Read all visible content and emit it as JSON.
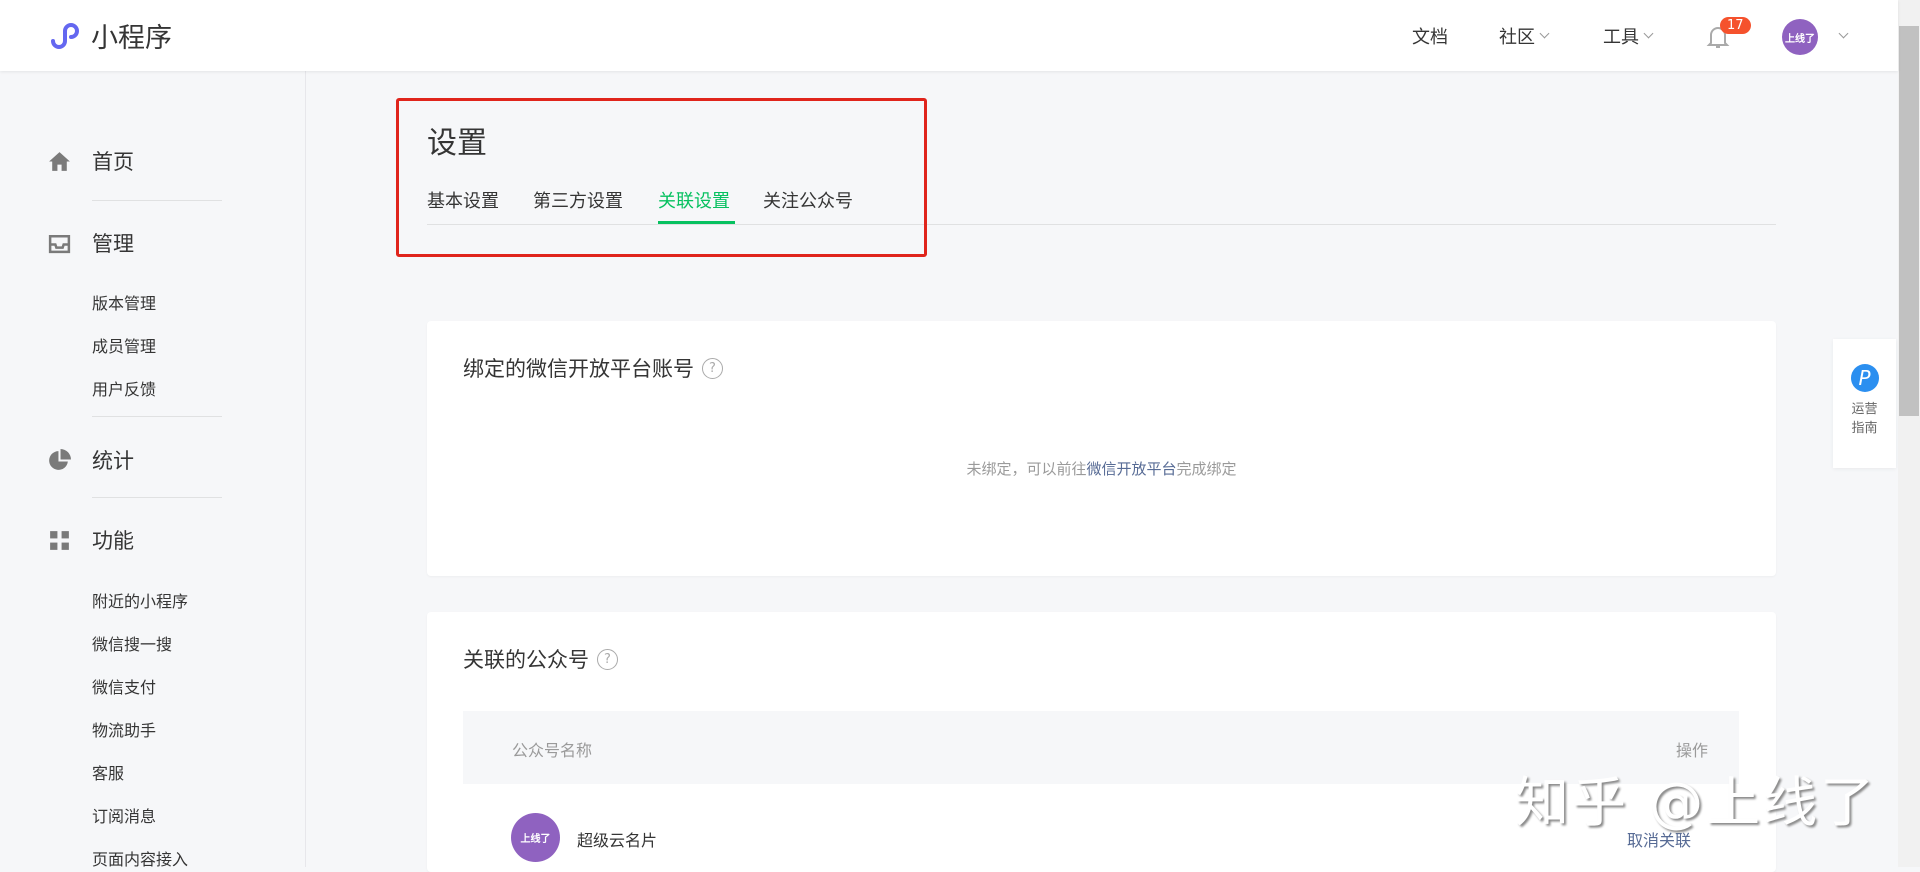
{
  "header": {
    "app_name": "小程序",
    "nav": [
      {
        "label": "文档"
      },
      {
        "label": "社区"
      },
      {
        "label": "工具"
      }
    ],
    "notification_count": "17",
    "avatar_text": "上线了"
  },
  "sidebar": {
    "sections": [
      {
        "label": "首页",
        "icon": "home-icon"
      },
      {
        "label": "管理",
        "icon": "inbox-icon",
        "items": [
          "版本管理",
          "成员管理",
          "用户反馈"
        ]
      },
      {
        "label": "统计",
        "icon": "pie-chart-icon"
      },
      {
        "label": "功能",
        "icon": "grid-icon",
        "items": [
          "附近的小程序",
          "微信搜一搜",
          "微信支付",
          "物流助手",
          "客服",
          "订阅消息",
          "页面内容接入"
        ]
      }
    ]
  },
  "page": {
    "title": "设置",
    "tabs": [
      {
        "label": "基本设置"
      },
      {
        "label": "第三方设置"
      },
      {
        "label": "关联设置",
        "active": true
      },
      {
        "label": "关注公众号"
      }
    ]
  },
  "open_platform": {
    "title": "绑定的微信开放平台账号",
    "empty_prefix": "未绑定，可以前往",
    "empty_link": "微信开放平台",
    "empty_suffix": "完成绑定"
  },
  "linked_accounts": {
    "title": "关联的公众号",
    "columns": [
      "公众号名称",
      "操作"
    ],
    "rows": [
      {
        "avatar_text": "上线了",
        "name": "超级云名片",
        "action": "取消关联"
      }
    ]
  },
  "float_helper": {
    "icon_letter": "P",
    "line1": "运营",
    "line2": "指南"
  },
  "watermark": "知乎 @上线了",
  "colors": {
    "accent": "#07c160",
    "link": "#576b95",
    "badge": "#f5522d",
    "highlight_box": "#e0251c",
    "avatar": "#8f62c0"
  }
}
